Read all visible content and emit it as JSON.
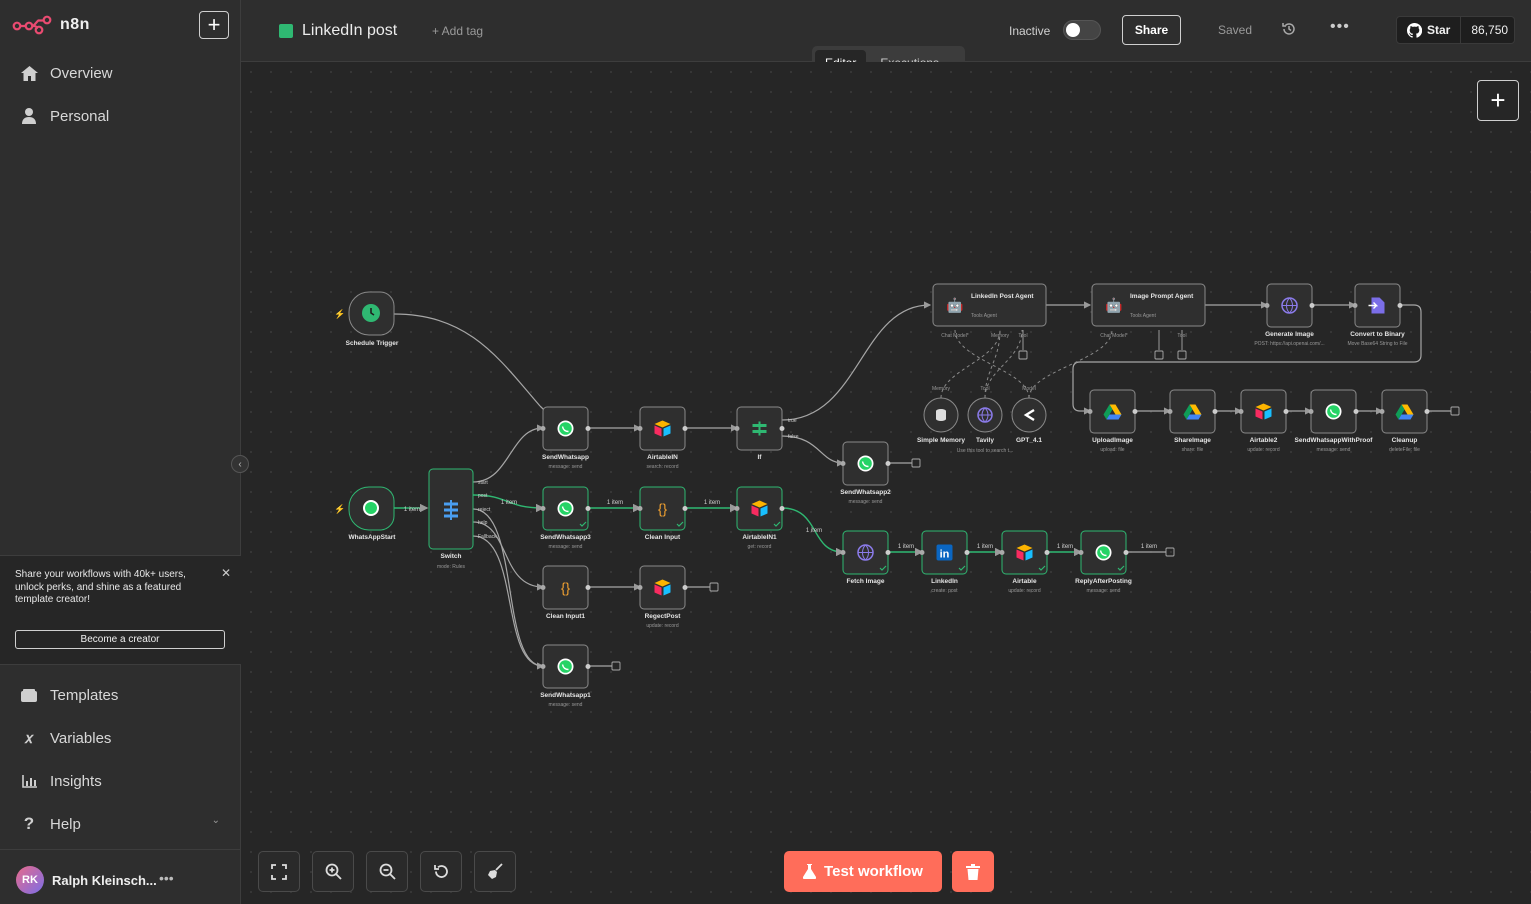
{
  "app": {
    "logo_text": "n8n"
  },
  "sidebar": {
    "items": [
      {
        "label": "Overview",
        "icon": "home-icon"
      },
      {
        "label": "Personal",
        "icon": "user-icon"
      }
    ],
    "bottom_items": [
      {
        "label": "Templates",
        "icon": "templates-icon"
      },
      {
        "label": "Variables",
        "icon": "variables-icon"
      },
      {
        "label": "Insights",
        "icon": "insights-icon"
      },
      {
        "label": "Help",
        "icon": "help-icon"
      }
    ],
    "promo": {
      "text": "Share your workflows with 40k+ users, unlock perks, and shine as a featured template creator!",
      "button": "Become a creator"
    },
    "user": {
      "initials": "RK",
      "name": "Ralph Kleinsch..."
    }
  },
  "header": {
    "workflow_name": "LinkedIn post",
    "add_tag": "+ Add tag",
    "status": "Inactive",
    "share": "Share",
    "saved": "Saved",
    "github": {
      "star": "Star",
      "count": "86,750"
    },
    "tabs": [
      {
        "label": "Editor",
        "active": true
      },
      {
        "label": "Executions",
        "active": false
      }
    ]
  },
  "canvas": {
    "test_button": "Test workflow",
    "nodes": [
      {
        "name": "Schedule Trigger",
        "sub": ""
      },
      {
        "name": "WhatsAppStart",
        "sub": ""
      },
      {
        "name": "Switch",
        "sub": "mode: Rules",
        "outputs": [
          "start",
          "post",
          "reject",
          "help",
          "Fallback"
        ]
      },
      {
        "name": "SendWhatsapp",
        "sub": "message: send"
      },
      {
        "name": "AirtableIN",
        "sub": "search: record"
      },
      {
        "name": "If",
        "sub": "",
        "outputs": [
          "true",
          "false"
        ]
      },
      {
        "name": "SendWhatsapp2",
        "sub": "message: send"
      },
      {
        "name": "SendWhatsapp3",
        "sub": "message: send"
      },
      {
        "name": "Clean Input",
        "sub": ""
      },
      {
        "name": "AirtableIN1",
        "sub": "get: record"
      },
      {
        "name": "Clean Input1",
        "sub": ""
      },
      {
        "name": "RegectPost",
        "sub": "update: record"
      },
      {
        "name": "SendWhatsapp1",
        "sub": "message: send"
      },
      {
        "name": "Fetch Image",
        "sub": ""
      },
      {
        "name": "LinkedIn",
        "sub": "create: post"
      },
      {
        "name": "Airtable",
        "sub": "update: record"
      },
      {
        "name": "ReplyAfterPosting",
        "sub": "message: send"
      },
      {
        "name": "LinkedIn Post Agent",
        "sub": "Tools Agent",
        "ports": [
          "Chat Model*",
          "Memory",
          "Tool"
        ]
      },
      {
        "name": "Image Prompt Agent",
        "sub": "Tools Agent",
        "ports": [
          "Chat Model*",
          "Tool"
        ]
      },
      {
        "name": "Generate Image",
        "sub": "POST: https://api.openai.com/..."
      },
      {
        "name": "Convert to Binary",
        "sub": "Move Base64 String to File"
      },
      {
        "name": "Simple Memory",
        "sub": ""
      },
      {
        "name": "Tavily",
        "sub": "Use this tool to search t..."
      },
      {
        "name": "GPT_4.1",
        "sub": ""
      },
      {
        "name": "UploadImage",
        "sub": "upload: file"
      },
      {
        "name": "ShareImage",
        "sub": "share: file"
      },
      {
        "name": "Airtable2",
        "sub": "update: record"
      },
      {
        "name": "SendWhatsappWithProof",
        "sub": "message: send"
      },
      {
        "name": "Cleanup",
        "sub": "deleteFile: file"
      }
    ],
    "edge_label": "1 item",
    "sub_port_labels": {
      "memory": "Memory",
      "tool": "Tool",
      "model": "Model"
    }
  },
  "colors": {
    "accent": "#ff6d5a",
    "node_bg": "#2f2f2f",
    "success": "#2fb872",
    "canvas": "#262626"
  }
}
